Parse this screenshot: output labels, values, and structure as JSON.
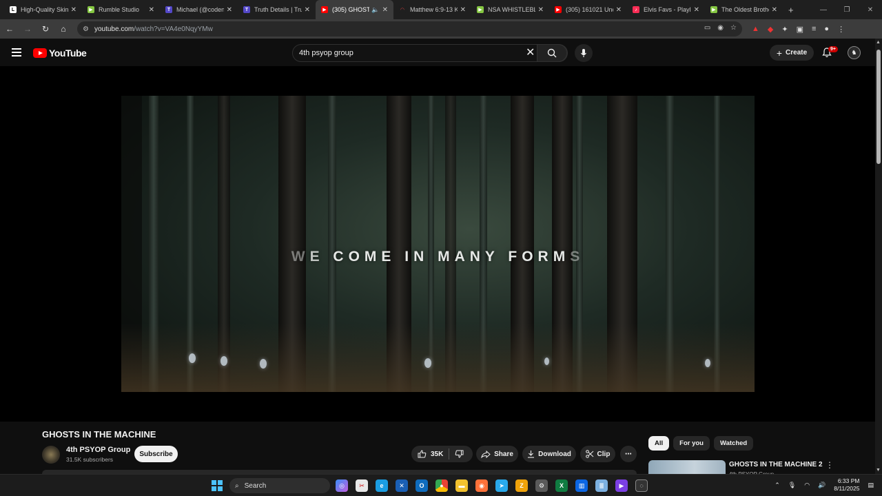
{
  "browser": {
    "tabs": [
      {
        "title": "High-Quality Skin",
        "fav_color": "#ffffff",
        "fav_letter": "L",
        "fav_text": "#000000"
      },
      {
        "title": "Rumble Studio",
        "fav_color": "#85c742",
        "fav_letter": "▶",
        "fav_text": "#ffffff"
      },
      {
        "title": "Michael (@coden",
        "fav_color": "#5448c8",
        "fav_letter": "T",
        "fav_text": "#ffffff"
      },
      {
        "title": "Truth Details | Trut",
        "fav_color": "#5448c8",
        "fav_letter": "T",
        "fav_text": "#ffffff"
      },
      {
        "title": "(305) GHOSTS",
        "fav_color": "#ff0000",
        "fav_letter": "▶",
        "fav_text": "#ffffff",
        "active": true
      },
      {
        "title": "Matthew 6:9-13 K",
        "fav_color": "#1f1f1f",
        "fav_letter": "◠",
        "fav_text": "#e04040"
      },
      {
        "title": "NSA WHISTLEBLO",
        "fav_color": "#85c742",
        "fav_letter": "▶",
        "fav_text": "#ffffff"
      },
      {
        "title": "(305) 161021 Uncl",
        "fav_color": "#ff0000",
        "fav_letter": "▶",
        "fav_text": "#ffffff"
      },
      {
        "title": "Elvis Favs - Playlis",
        "fav_color": "#fa2d55",
        "fav_letter": "♪",
        "fav_text": "#ffffff"
      },
      {
        "title": "The Oldest Brothe",
        "fav_color": "#85c742",
        "fav_letter": "▶",
        "fav_text": "#ffffff"
      }
    ],
    "new_tab": "+",
    "url_host": "youtube.com",
    "url_path": "/watch?v=VA4e0NqyYMw"
  },
  "youtube": {
    "logo_text": "YouTube",
    "search_value": "4th psyop group",
    "create_label": "Create",
    "notif_badge": "9+",
    "video_caption_main": "WE COME IN MANY FORM",
    "video_caption_first": "W",
    "video_caption_second": "E",
    "video_caption_last": "S",
    "title": "GHOSTS IN THE MACHINE",
    "channel_name": "4th PSYOP Group",
    "subscribers": "31.5K subscribers",
    "subscribe_label": "Subscribe",
    "likes": "35K",
    "share_label": "Share",
    "download_label": "Download",
    "clip_label": "Clip",
    "chips": [
      "All",
      "For you",
      "Watched"
    ],
    "related_title": "GHOSTS IN THE MACHINE 2",
    "related_channel": "4th PSYOP Group"
  },
  "taskbar": {
    "search_label": "Search",
    "time": "6:33 PM",
    "date": "8/11/2025"
  },
  "colors": {
    "accent_red": "#ff0000",
    "background": "#0f0f0f"
  }
}
